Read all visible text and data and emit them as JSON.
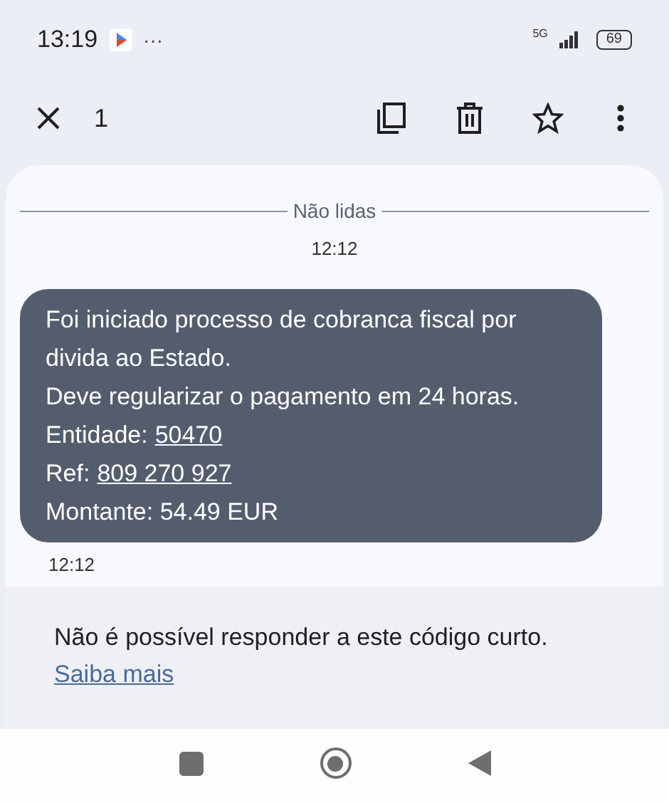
{
  "status_bar": {
    "time": "13:19",
    "more": "···",
    "network": "5G",
    "battery": "69"
  },
  "toolbar": {
    "selected_count": "1"
  },
  "divider": {
    "label": "Não lidas"
  },
  "message": {
    "time_above": "12:12",
    "lines": [
      {
        "kind": "text",
        "text": "Foi iniciado processo de cobranca fiscal por divida ao Estado."
      },
      {
        "kind": "text",
        "text": "Deve regularizar o pagamento em 24 horas."
      },
      {
        "kind": "link",
        "label": "Entidade:",
        "link": "50470"
      },
      {
        "kind": "link",
        "label": "Ref:",
        "link": "809 270 927"
      },
      {
        "kind": "text",
        "text": "Montante: 54.49 EUR"
      }
    ],
    "time_below": "12:12"
  },
  "footer": {
    "notice": "Não é possível responder a este código curto.",
    "link": "Saiba mais"
  }
}
